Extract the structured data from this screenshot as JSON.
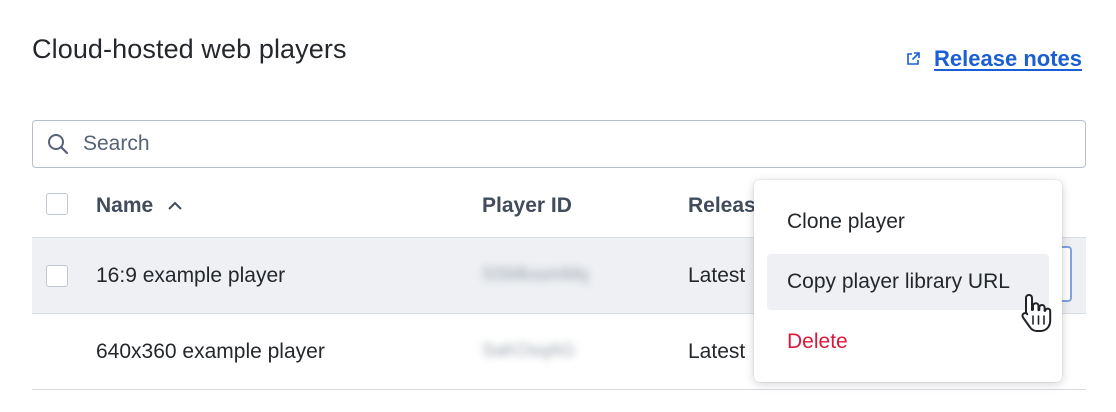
{
  "header": {
    "title": "Cloud-hosted web players",
    "release_notes_label": "Release notes"
  },
  "search": {
    "placeholder": "Search",
    "value": ""
  },
  "table": {
    "columns": [
      "Name",
      "Player ID",
      "Releas"
    ],
    "sort": {
      "column": "Name",
      "direction": "ascending"
    },
    "rows": [
      {
        "name": "16:9 example player",
        "player_id": "SSMkssmMq",
        "release": "Latest"
      },
      {
        "name": "640x360 example player",
        "player_id": "SaKOsqAG",
        "release": "Latest"
      }
    ]
  },
  "context_menu": {
    "items": [
      {
        "label": "Clone player"
      },
      {
        "label": "Copy player library URL"
      },
      {
        "label": "Delete"
      }
    ]
  },
  "colors": {
    "accent": "#1a5fd6",
    "danger": "#d81b3c",
    "row_highlight": "#eef0f3"
  },
  "icons": {
    "release_notes": "external-link-icon",
    "search": "search-icon",
    "sort": "chevron-up-icon",
    "cursor": "hand-pointer-icon"
  }
}
